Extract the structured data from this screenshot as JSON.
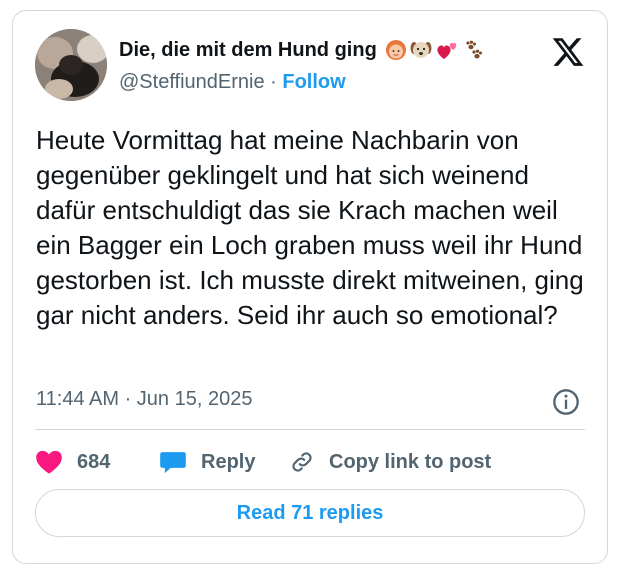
{
  "author": {
    "display_name": "Die, die mit dem Hund ging",
    "handle": "@SteffiundErnie",
    "separator": "·",
    "follow_label": "Follow",
    "name_emojis": [
      "woman-emoji",
      "dog-face-emoji",
      "two-hearts-emoji",
      "paw-prints-emoji"
    ]
  },
  "tweet": {
    "text": "Heute Vormittag hat meine Nachbarin von gegenüber geklingelt und hat sich weinend dafür entschuldigt das sie Krach machen weil ein Bagger ein Loch graben muss weil ihr Hund gestorben ist. Ich musste direkt mitweinen, ging gar nicht anders. Seid ihr auch so emotional?",
    "timestamp": "11:44 AM · Jun 15, 2025"
  },
  "actions": {
    "like_count": "684",
    "reply_label": "Reply",
    "copy_label": "Copy link to post"
  },
  "read_replies_label": "Read 71 replies",
  "colors": {
    "accent": "#1d9bf0",
    "like": "#f91880",
    "text": "#0f1419",
    "muted": "#536471",
    "border": "#cfd9de"
  }
}
